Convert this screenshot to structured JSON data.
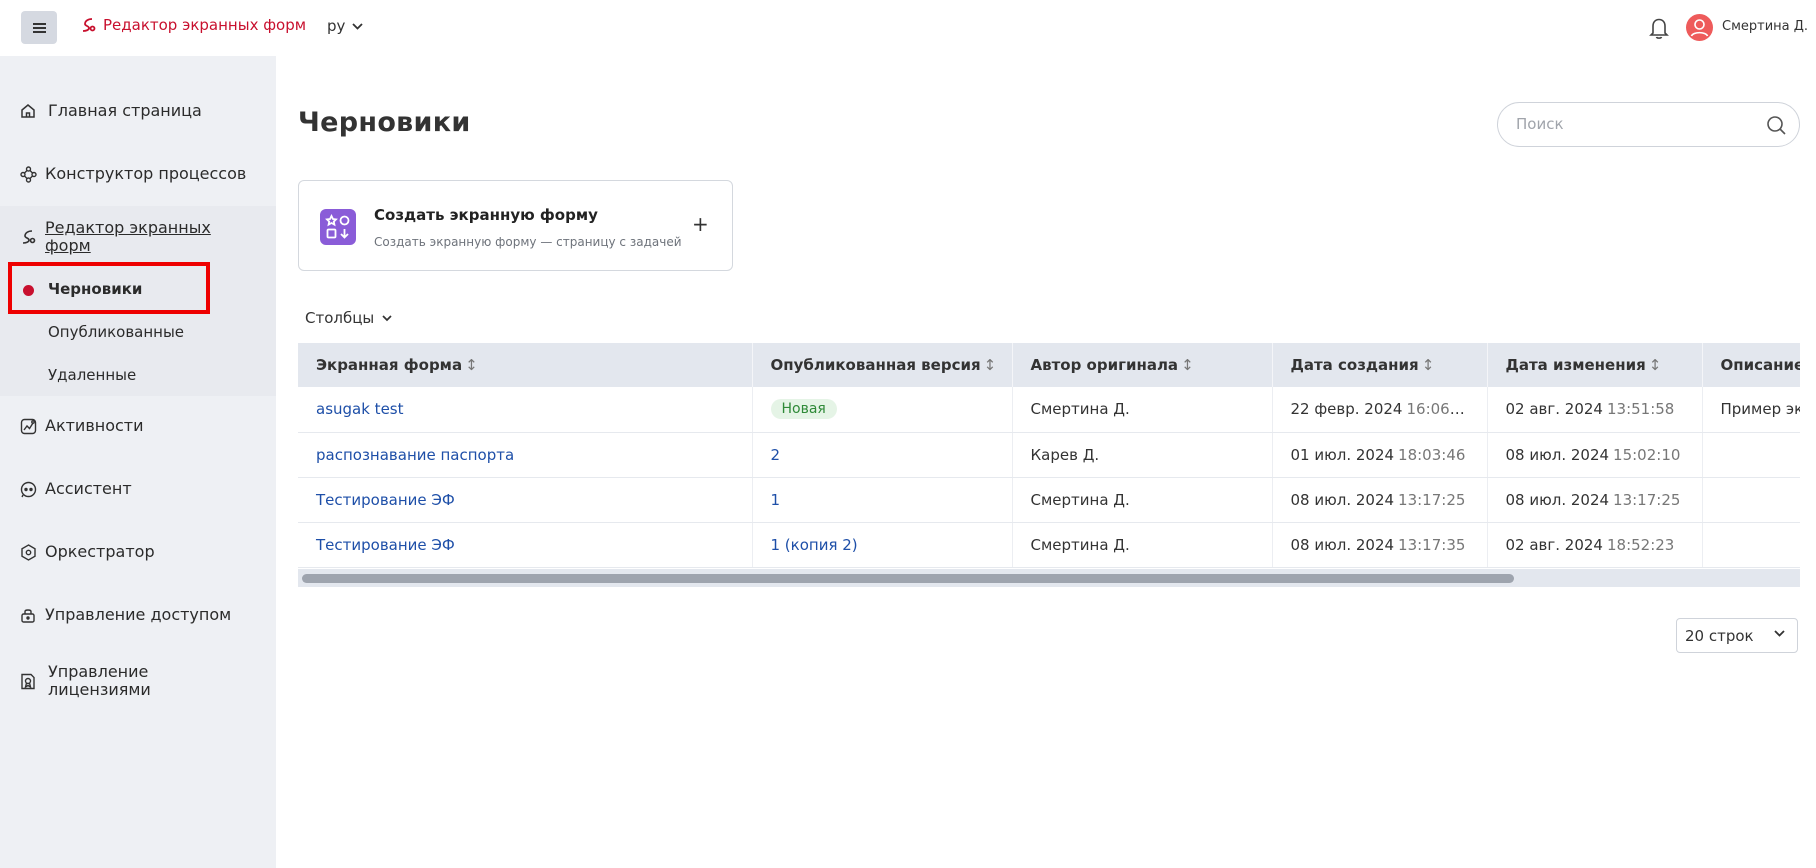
{
  "header": {
    "app_name": "Редактор экранных форм",
    "language": "ру",
    "user_name": "Смертина Д."
  },
  "sidebar": {
    "items": [
      {
        "label": "Главная страница",
        "icon": "home-icon"
      },
      {
        "label": "Конструктор процессов",
        "icon": "process-icon"
      },
      {
        "label": "Редактор экранных форм",
        "icon": "form-editor-icon"
      },
      {
        "label": "Активности",
        "icon": "activity-icon"
      },
      {
        "label": "Ассистент",
        "icon": "assistant-icon"
      },
      {
        "label": "Оркестратор",
        "icon": "orchestrator-icon"
      },
      {
        "label": "Управление доступом",
        "icon": "lock-icon"
      },
      {
        "label": "Управление лицензиями",
        "icon": "license-icon"
      }
    ],
    "subitems": [
      {
        "label": "Черновики",
        "active": true
      },
      {
        "label": "Опубликованные",
        "active": false
      },
      {
        "label": "Удаленные",
        "active": false
      }
    ]
  },
  "main": {
    "title": "Черновики",
    "search_placeholder": "Поиск",
    "create_card": {
      "title": "Создать экранную форму",
      "subtitle": "Создать экранную форму — страницу с задачей",
      "plus": "+"
    },
    "columns_label": "Столбцы",
    "sort_glyph": "↕",
    "table": {
      "headers": [
        "Экранная форма",
        "Опубликованная версия",
        "Автор оригинала",
        "Дата создания",
        "Дата изменения",
        "Описание"
      ],
      "rows": [
        {
          "name": "asugak test",
          "version": "Новая",
          "version_is_badge": true,
          "author": "Смертина Д.",
          "created_date": "22 февр. 2024",
          "created_time": "16:06:...",
          "modified_date": "02 авг. 2024",
          "modified_time": "13:51:58",
          "description": "Пример экр"
        },
        {
          "name": "распознавание паспорта",
          "version": "2",
          "version_is_badge": false,
          "author": "Карев Д.",
          "created_date": "01 июл. 2024",
          "created_time": "18:03:46",
          "modified_date": "08 июл. 2024",
          "modified_time": "15:02:10",
          "description": ""
        },
        {
          "name": "Тестирование ЭФ",
          "version": "1",
          "version_is_badge": false,
          "author": "Смертина Д.",
          "created_date": "08 июл. 2024",
          "created_time": "13:17:25",
          "modified_date": "08 июл. 2024",
          "modified_time": "13:17:25",
          "description": ""
        },
        {
          "name": "Тестирование ЭФ",
          "version": "1 (копия 2)",
          "version_is_badge": false,
          "author": "Смертина Д.",
          "created_date": "08 июл. 2024",
          "created_time": "13:17:35",
          "modified_date": "02 авг. 2024",
          "modified_time": "18:52:23",
          "description": ""
        }
      ]
    },
    "rows_per_page": "20 строк"
  },
  "colors": {
    "brand_red": "#c8102e",
    "sidebar_bg": "#eef0f4",
    "link_blue": "#1e4fa8",
    "badge_green": "#2f8a38",
    "card_icon_purple": "#8a5cd8",
    "highlight_red": "#ee0000"
  }
}
